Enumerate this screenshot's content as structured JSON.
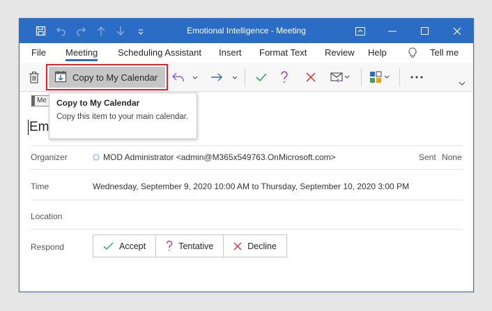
{
  "window": {
    "title": "Emotional Intelligence  -  Meeting"
  },
  "menu": {
    "tabs": [
      {
        "label": "File"
      },
      {
        "label": "Meeting"
      },
      {
        "label": "Scheduling Assistant"
      },
      {
        "label": "Insert"
      },
      {
        "label": "Format Text"
      },
      {
        "label": "Review"
      },
      {
        "label": "Help"
      },
      {
        "label": "Tell me"
      }
    ]
  },
  "ribbon": {
    "copy_to_calendar_label": "Copy to My Calendar"
  },
  "tooltip": {
    "title": "Copy to My Calendar",
    "body": "Copy this item to your main calendar."
  },
  "tag": {
    "label": "Me"
  },
  "subject": {
    "text": "Em"
  },
  "details": {
    "organizer_label": "Organizer",
    "organizer_value": "MOD Administrator <admin@M365x549763.OnMicrosoft.com>",
    "sent_label": "Sent",
    "sent_value": "None",
    "time_label": "Time",
    "time_value": "Wednesday, September 9, 2020 10:00 AM to Thursday, September 10, 2020 3:00 PM",
    "location_label": "Location",
    "respond_label": "Respond"
  },
  "respond": {
    "accept": "Accept",
    "tentative": "Tentative",
    "decline": "Decline"
  },
  "colors": {
    "titlebar": "#2b6cc4",
    "highlight": "#e0202a",
    "accept_green": "#3aa655",
    "tentative_purple": "#a43ab0",
    "decline_red": "#d9302e"
  }
}
